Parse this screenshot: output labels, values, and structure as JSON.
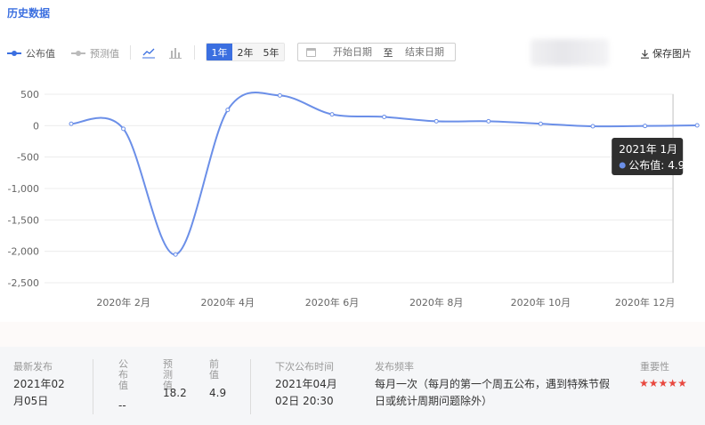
{
  "section_title": "历史数据",
  "legend": {
    "actual": "公布值",
    "forecast": "预测值"
  },
  "icons": {
    "line_chart": "line-chart-icon",
    "bar_chart": "bar-chart-icon",
    "calendar": "calendar-icon",
    "download": "download-icon"
  },
  "range_buttons": [
    "1年",
    "2年",
    "5年"
  ],
  "range_active": "1年",
  "date_range": {
    "start_placeholder": "开始日期",
    "separator": "至",
    "end_placeholder": "结束日期"
  },
  "save_label": "保存图片",
  "colors": {
    "accent": "#3b6fe0",
    "series": "#6b8fe8",
    "highlight_band": "#dcdcdc",
    "tooltip_bg": "#2f2f2f",
    "stars": "#e8483f"
  },
  "chart_data": {
    "type": "line",
    "x": [
      "2020-01",
      "2020-02",
      "2020-03",
      "2020-04",
      "2020-05",
      "2020-06",
      "2020-07",
      "2020-08",
      "2020-09",
      "2020-10",
      "2020-11",
      "2020-12",
      "2021-01"
    ],
    "x_tick_labels": [
      "2020年 2月",
      "2020年 4月",
      "2020年 6月",
      "2020年 8月",
      "2020年 10月",
      "2020年 12月"
    ],
    "x_tick_dates": [
      "2020-02",
      "2020-04",
      "2020-06",
      "2020-08",
      "2020-10",
      "2020-12"
    ],
    "series": [
      {
        "name": "公布值",
        "values": [
          30,
          -50,
          -2050,
          250,
          480,
          180,
          140,
          70,
          70,
          30,
          -10,
          -5,
          4.9
        ]
      }
    ],
    "y_ticks": [
      500,
      0,
      -500,
      -1000,
      -1500,
      -2000,
      -2500
    ],
    "y_tick_labels": [
      "500",
      "0",
      "-500",
      "-1,000",
      "-1,500",
      "-2,000",
      "-2,500"
    ],
    "ylim": [
      -2500,
      500
    ],
    "highlight_x": "2021-01",
    "tooltip": {
      "title": "2021年 1月",
      "series_label": "公布值:",
      "value": "4.9"
    },
    "grid": true
  },
  "info": {
    "latest_release_label": "最新发布",
    "latest_release_value": "2021年02月05日",
    "actual_label": "公布值",
    "actual_value": "--",
    "forecast_label": "预测值",
    "forecast_value": "18.2",
    "previous_label": "前值",
    "previous_value": "4.9",
    "next_release_label": "下次公布时间",
    "next_release_value": "2021年04月02日 20:30",
    "frequency_label": "发布频率",
    "frequency_value": "每月一次（每月的第一个周五公布，遇到特殊节假日或统计周期问题除外）",
    "importance_label": "重要性",
    "importance_stars": 5
  }
}
